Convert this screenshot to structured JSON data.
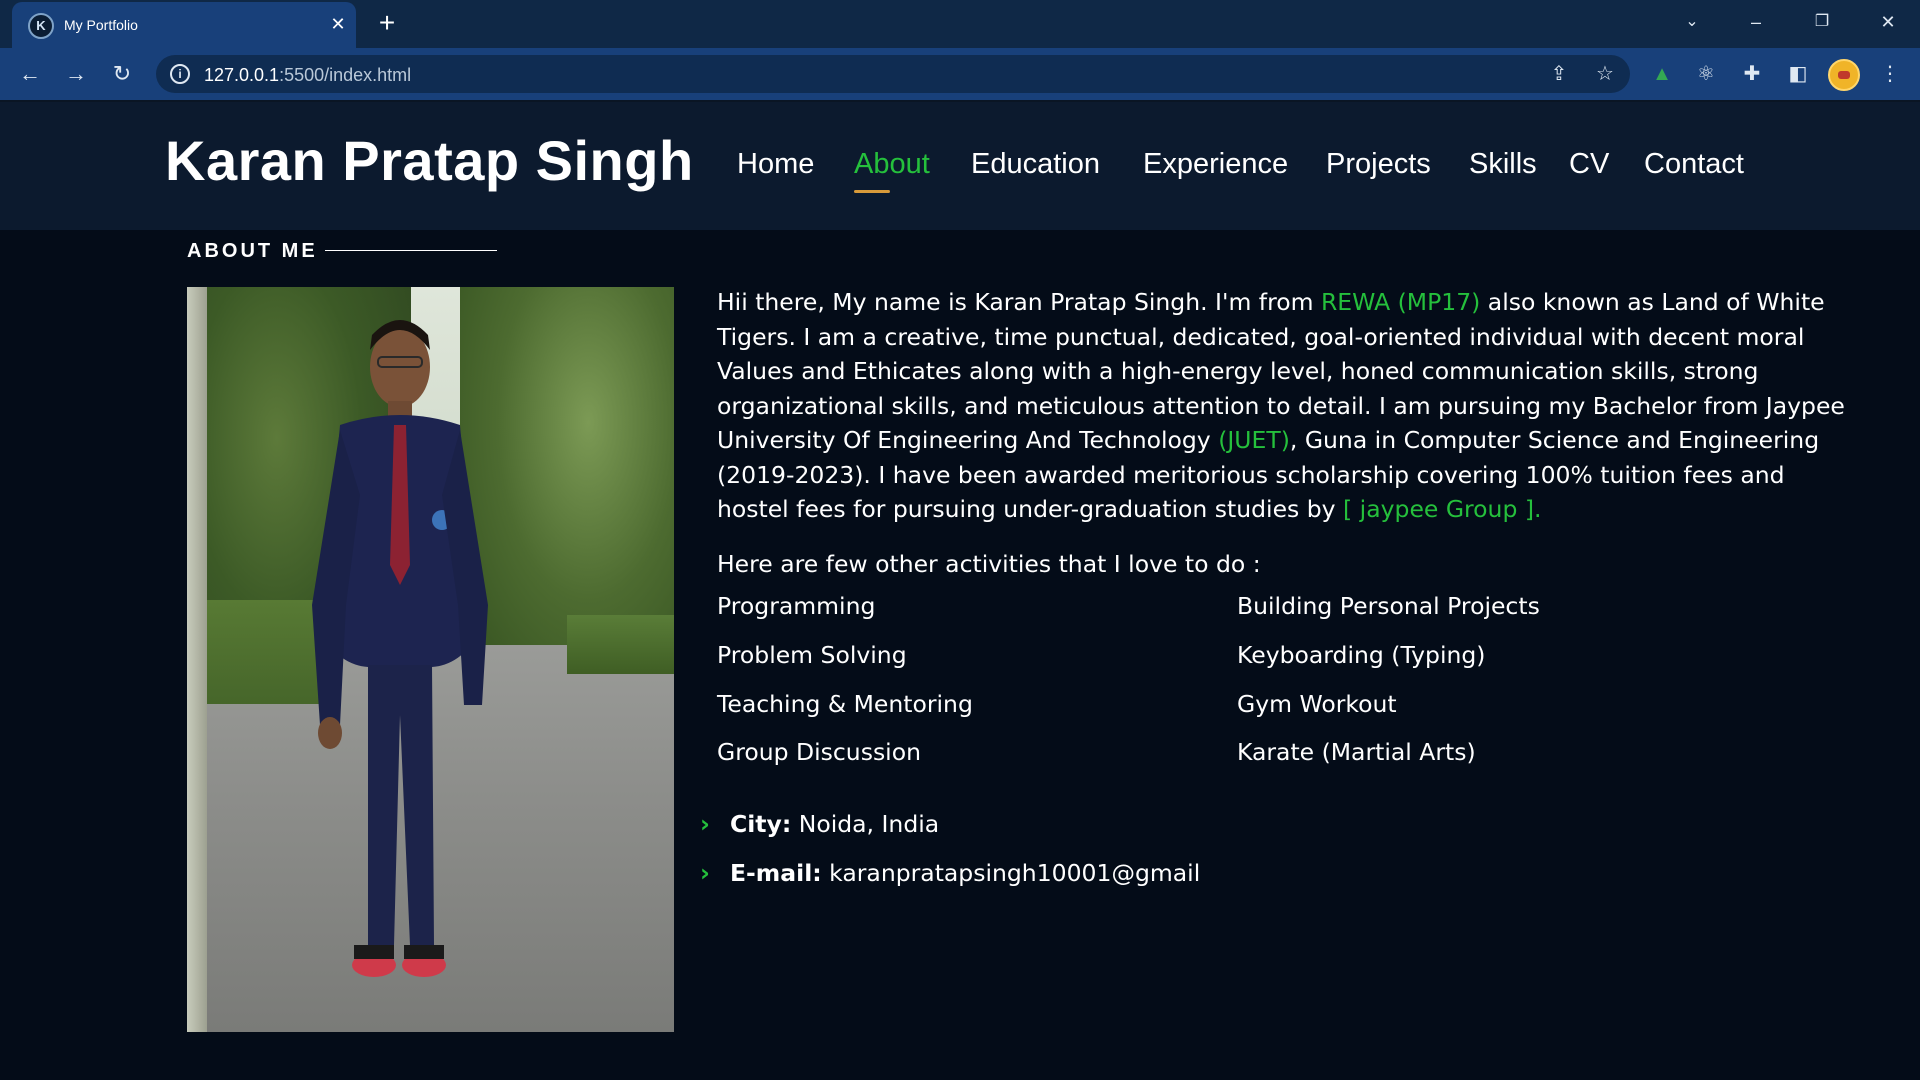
{
  "browser": {
    "tab_title": "My Portfolio",
    "tab_favicon_letter": "K",
    "url_host": "127.0.0.1",
    "url_path": ":5500/index.html"
  },
  "site": {
    "brand": "Karan Pratap Singh",
    "nav": [
      "Home",
      "About",
      "Education",
      "Experience",
      "Projects",
      "Skills",
      "CV",
      "Contact"
    ],
    "active_nav": "About",
    "accent_color": "#25c03c",
    "underline_color": "#d89a3a"
  },
  "about": {
    "section_title": "ABOUT ME",
    "lines": [
      {
        "before": "Hii there, My name is Karan Pratap Singh. I'm from ",
        "hl": "REWA (MP17)",
        "after": " also known as Land of White"
      },
      {
        "before": "Tigers. I am a creative, time punctual, dedicated, goal-oriented individual with decent moral",
        "hl": "",
        "after": ""
      },
      {
        "before": "Values and Ethicates along with a high-energy level, honed communication skills, strong",
        "hl": "",
        "after": ""
      },
      {
        "before": "organizational skills, and meticulous attention to detail. I am pursuing my Bachelor from Jaypee",
        "hl": "",
        "after": ""
      },
      {
        "before": "University Of Engineering And Technology ",
        "hl": "(JUET)",
        "after": ", Guna in Computer Science and Engineering"
      },
      {
        "before": "(2019-2023). I have been awarded meritorious scholarship covering 100% tuition fees and",
        "hl": "",
        "after": ""
      },
      {
        "before": "hostel fees for pursuing under-graduation studies by ",
        "hl": "[ jaypee Group ].",
        "after": ""
      }
    ],
    "activities_intro": "Here are few other activities that I love to do :",
    "activities_left": [
      "Programming",
      "Problem Solving",
      "Teaching & Mentoring",
      "Group Discussion"
    ],
    "activities_right": [
      "Building Personal Projects",
      "Keyboarding (Typing)",
      "Gym Workout",
      "Karate (Martial Arts)"
    ],
    "info": [
      {
        "label": "City:",
        "value": "Noida, India"
      },
      {
        "label": "E-mail:",
        "value": "karanpratapsingh10001@gmail"
      }
    ]
  }
}
